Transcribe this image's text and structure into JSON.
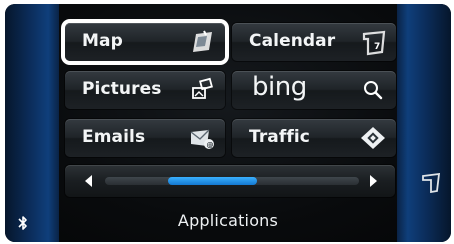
{
  "screen": {
    "title": "Applications",
    "selected_tile": "Map"
  },
  "tiles": [
    {
      "label": "Map",
      "icon": "map-icon",
      "selected": true
    },
    {
      "label": "Calendar",
      "icon": "calendar-icon",
      "selected": false
    },
    {
      "label": "Pictures",
      "icon": "pictures-icon",
      "selected": false
    },
    {
      "label": "bing",
      "icon": "search-icon",
      "selected": false
    },
    {
      "label": "Emails",
      "icon": "email-icon",
      "selected": false
    },
    {
      "label": "Traffic",
      "icon": "traffic-icon",
      "selected": false
    }
  ],
  "scroll": {
    "position_fraction": 0.38,
    "thumb_fraction": 0.35,
    "left_icon": "arrow-left-icon",
    "right_icon": "arrow-right-icon"
  },
  "status": {
    "bluetooth_icon": "bluetooth-icon",
    "corner_icon": "apps-corner-icon"
  },
  "colors": {
    "accent": "#1a8ee8",
    "side_panel": "#0f3f7b",
    "selection_outline": "#ffffff"
  }
}
